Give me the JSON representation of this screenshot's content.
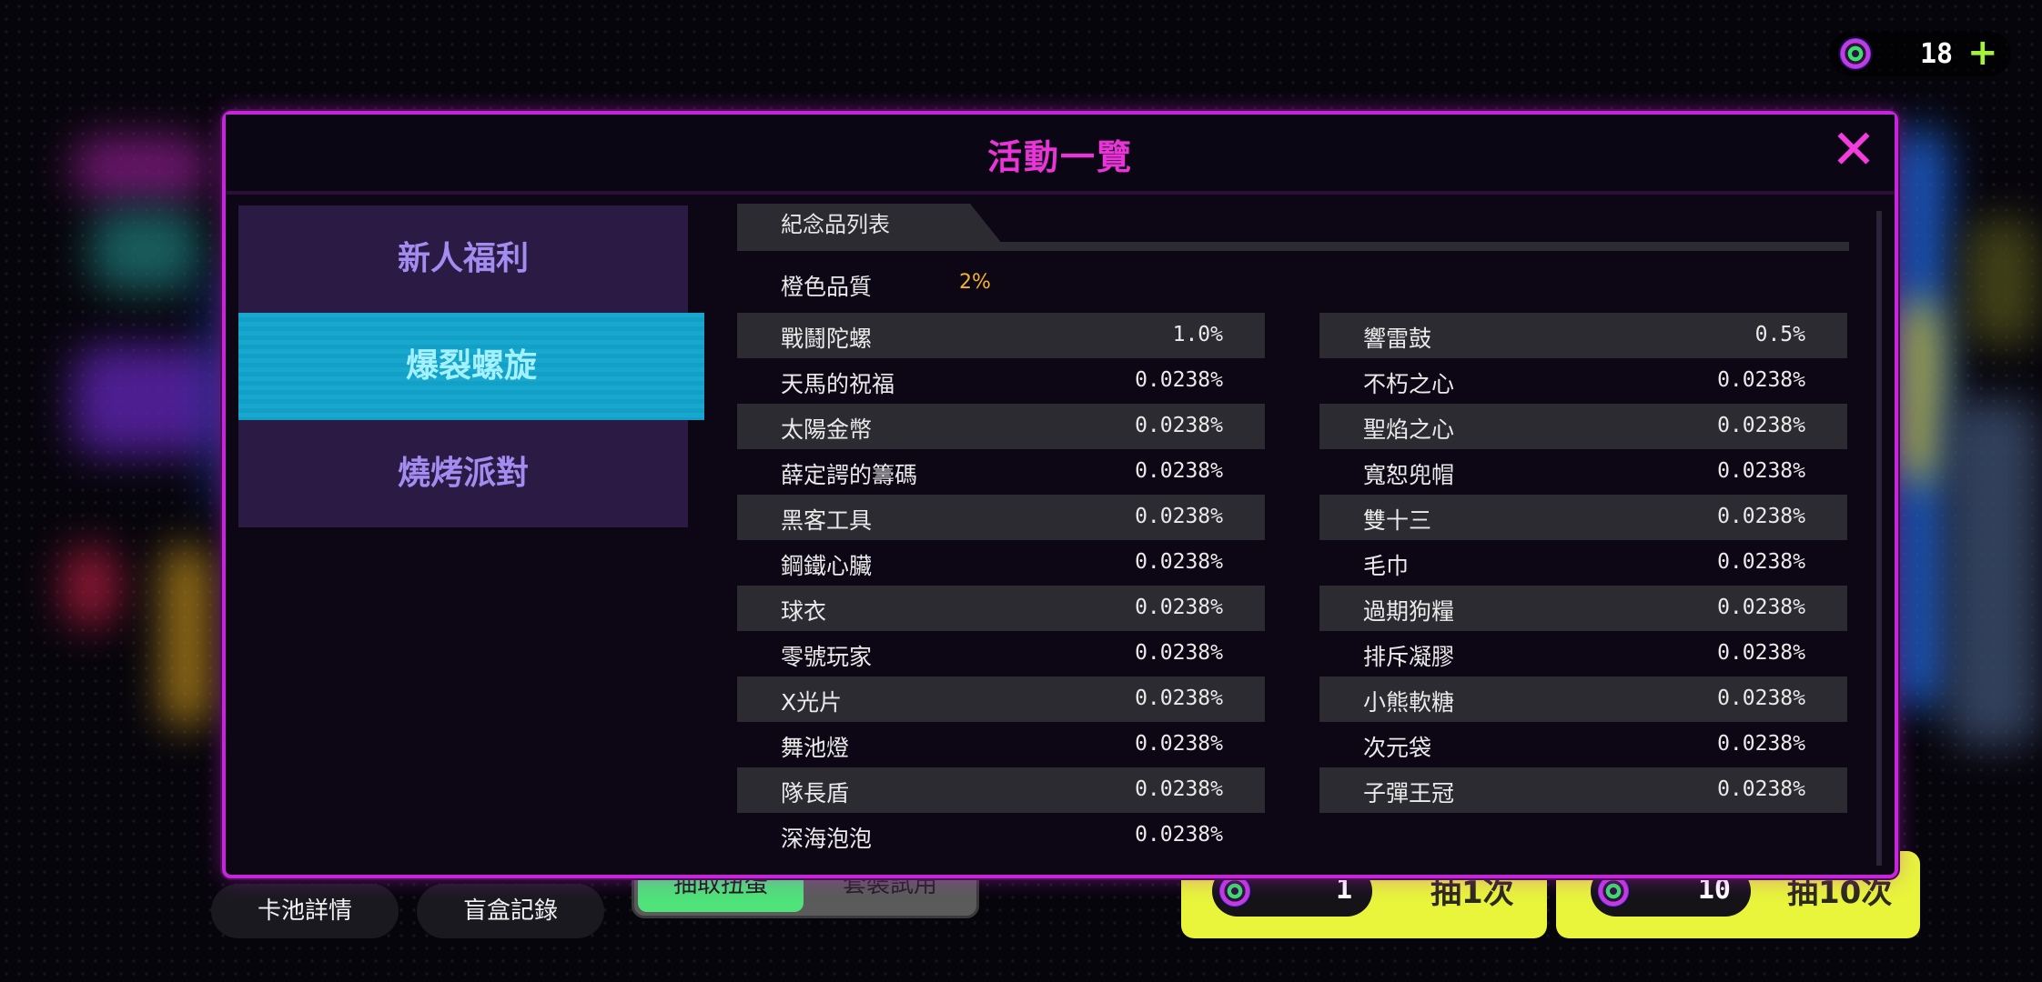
{
  "currency": {
    "amount": "18",
    "plus": "+"
  },
  "dialog": {
    "title": "活動一覽",
    "close": "✕"
  },
  "tabs": [
    {
      "label": "新人福利"
    },
    {
      "label": "爆裂螺旋"
    },
    {
      "label": "燒烤派對"
    }
  ],
  "section": {
    "title": "紀念品列表",
    "quality_name": "橙色品質",
    "quality_rate": "2%"
  },
  "items_left": [
    {
      "name": "戰鬪陀螺",
      "rate": "1.0%"
    },
    {
      "name": "天馬的祝福",
      "rate": "0.0238%"
    },
    {
      "name": "太陽金幣",
      "rate": "0.0238%"
    },
    {
      "name": "薛定諤的籌碼",
      "rate": "0.0238%"
    },
    {
      "name": "黑客工具",
      "rate": "0.0238%"
    },
    {
      "name": "鋼鐵心臟",
      "rate": "0.0238%"
    },
    {
      "name": "球衣",
      "rate": "0.0238%"
    },
    {
      "name": "零號玩家",
      "rate": "0.0238%"
    },
    {
      "name": "X光片",
      "rate": "0.0238%"
    },
    {
      "name": "舞池燈",
      "rate": "0.0238%"
    },
    {
      "name": "隊長盾",
      "rate": "0.0238%"
    },
    {
      "name": "深海泡泡",
      "rate": "0.0238%"
    }
  ],
  "items_right": [
    {
      "name": "響雷鼓",
      "rate": "0.5%"
    },
    {
      "name": "不朽之心",
      "rate": "0.0238%"
    },
    {
      "name": "聖焰之心",
      "rate": "0.0238%"
    },
    {
      "name": "寬恕兜帽",
      "rate": "0.0238%"
    },
    {
      "name": "雙十三",
      "rate": "0.0238%"
    },
    {
      "name": "毛巾",
      "rate": "0.0238%"
    },
    {
      "name": "過期狗糧",
      "rate": "0.0238%"
    },
    {
      "name": "排斥凝膠",
      "rate": "0.0238%"
    },
    {
      "name": "小熊軟糖",
      "rate": "0.0238%"
    },
    {
      "name": "次元袋",
      "rate": "0.0238%"
    },
    {
      "name": "子彈王冠",
      "rate": "0.0238%"
    }
  ],
  "bottom": {
    "pool_details": "卡池詳情",
    "blindbox_record": "盲盒記錄",
    "toggle_a": "抽取扭蛋",
    "toggle_b": "套裝試用",
    "draw1_count": "1",
    "draw1_label": "抽1次",
    "draw10_count": "10",
    "draw10_label": "抽10次"
  },
  "colors": {
    "accent": "#c526d9",
    "title": "#e935d8",
    "active_tab": "#17a7cf",
    "rate_highlight": "#f4b329",
    "draw_button": "#e8f53b",
    "toggle_on": "#4fe37a"
  }
}
